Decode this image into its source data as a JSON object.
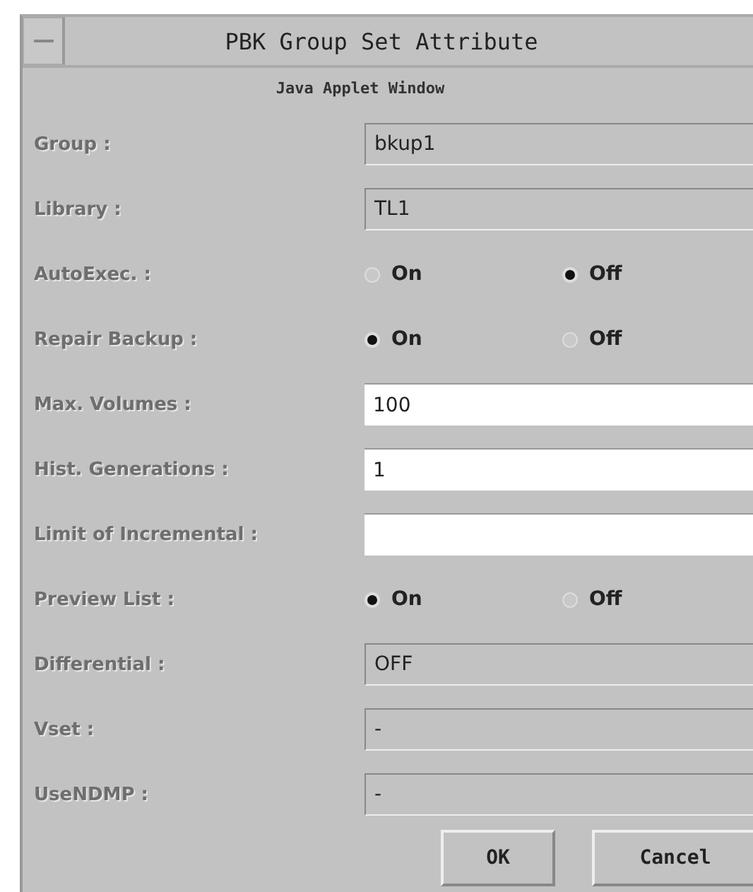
{
  "window": {
    "title": "PBK Group Set Attribute",
    "subtitle": "Java Applet Window"
  },
  "rows": [
    {
      "kind": "readonly",
      "label": "Group :",
      "value": "bkup1"
    },
    {
      "kind": "readonly",
      "label": "Library :",
      "value": "TL1"
    },
    {
      "kind": "radio",
      "label": "AutoExec. :",
      "options": [
        {
          "label": "On",
          "selected": false
        },
        {
          "label": "Off",
          "selected": true
        }
      ]
    },
    {
      "kind": "radio",
      "label": "Repair Backup :",
      "options": [
        {
          "label": "On",
          "selected": true
        },
        {
          "label": "Off",
          "selected": false
        }
      ]
    },
    {
      "kind": "input",
      "label": "Max. Volumes :",
      "value": "100"
    },
    {
      "kind": "input",
      "label": "Hist. Generations :",
      "value": "1"
    },
    {
      "kind": "input",
      "label": "Limit of Incremental :"
    },
    {
      "kind": "radio",
      "label": "Preview List :",
      "options": [
        {
          "label": "On",
          "selected": true
        },
        {
          "label": "Off",
          "selected": false
        }
      ]
    },
    {
      "kind": "readonly",
      "label": "Differential :",
      "value": "OFF"
    },
    {
      "kind": "readonly",
      "label": "Vset :",
      "value": "-"
    },
    {
      "kind": "readonly",
      "label": "UseNDMP :",
      "value": "-"
    }
  ],
  "buttons": [
    "OK",
    "Cancel"
  ]
}
